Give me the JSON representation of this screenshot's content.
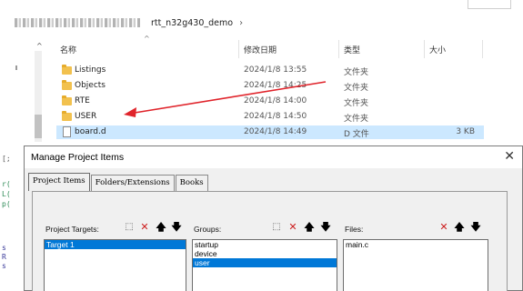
{
  "explorer": {
    "breadcrumb": {
      "current_folder": "rtt_n32g430_demo",
      "separator": "›"
    },
    "columns": {
      "name": "名称",
      "date": "修改日期",
      "type": "类型",
      "size": "大小"
    },
    "files": [
      {
        "name": "Listings",
        "date": "2024/1/8 13:55",
        "type": "文件夹",
        "size": "",
        "icon": "folder-icon"
      },
      {
        "name": "Objects",
        "date": "2024/1/8 14:25",
        "type": "文件夹",
        "size": "",
        "icon": "folder-icon"
      },
      {
        "name": "RTE",
        "date": "2024/1/8 14:00",
        "type": "文件夹",
        "size": "",
        "icon": "folder-icon"
      },
      {
        "name": "USER",
        "date": "2024/1/8 14:50",
        "type": "文件夹",
        "size": "",
        "icon": "folder-icon",
        "selected": true
      },
      {
        "name": "board.d",
        "date": "2024/1/8 14:49",
        "type": "D 文件",
        "size": "3 KB",
        "icon": "document-icon"
      }
    ],
    "annotation_color": "#e0242b"
  },
  "dialog": {
    "title": "Manage Project Items",
    "close_label": "✕",
    "tabs": [
      {
        "label": "Project Items",
        "active": true
      },
      {
        "label": "Folders/Extensions",
        "active": false
      },
      {
        "label": "Books",
        "active": false
      }
    ],
    "targets": {
      "label": "Project Targets:",
      "items": [
        "Target 1"
      ],
      "selected_index": 0
    },
    "groups": {
      "label": "Groups:",
      "items": [
        "startup",
        "device",
        "user"
      ],
      "selected_index": 2
    },
    "files": {
      "label": "Files:",
      "items": [
        "main.c"
      ]
    },
    "icons": {
      "new": "⬚",
      "delete": "✕",
      "up": "🡅",
      "down": "🡇"
    },
    "selection_color": "#0078d7"
  }
}
